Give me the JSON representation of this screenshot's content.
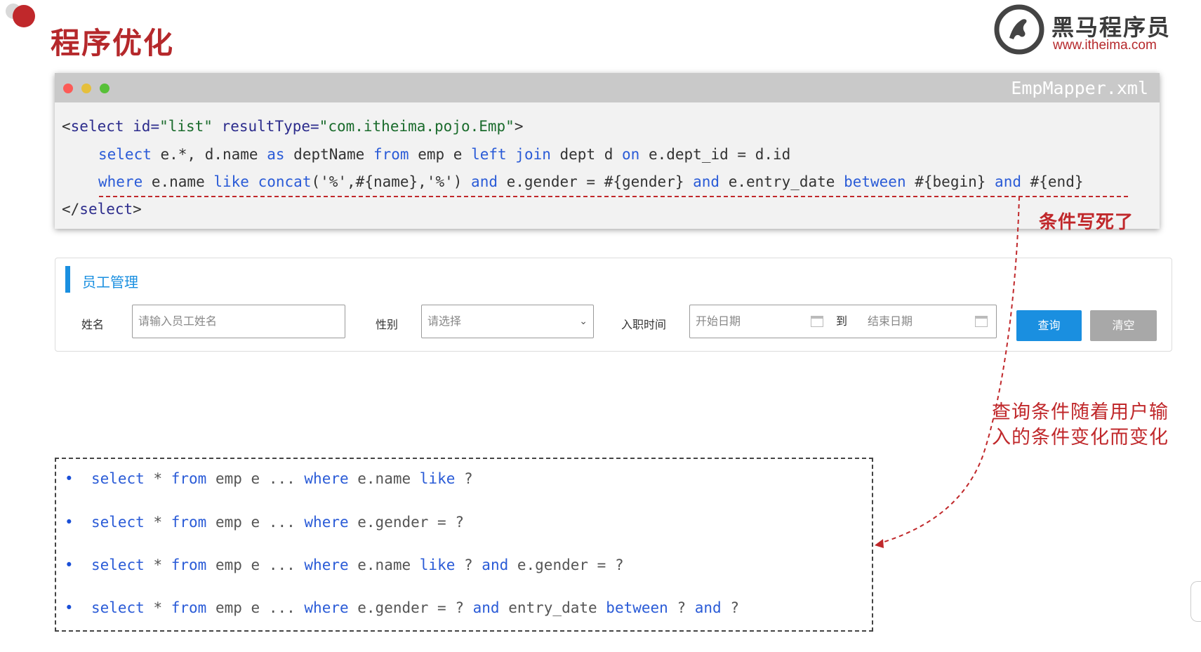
{
  "slide": {
    "title": "程序优化"
  },
  "logo": {
    "name": "黑马程序员",
    "url": "www.itheima.com"
  },
  "code_window": {
    "filename": "EmpMapper.xml",
    "line1": {
      "open": "<",
      "tag": "select",
      "attr1": " id=",
      "val1": "\"list\"",
      "attr2": " resultType=",
      "val2": "\"com.itheima.pojo.Emp\"",
      "close": ">"
    },
    "line2": {
      "select": "select",
      "t1": " e.*, d.name ",
      "as": "as",
      "t2": " deptName ",
      "from": "from",
      "t3": " emp e ",
      "left": "left",
      "sp": " ",
      "join": "join",
      "t4": " dept d ",
      "on": "on",
      "t5": " e.dept_id = d.id"
    },
    "line3": {
      "where": "where",
      "t1": " e.name ",
      "like": "like",
      "sp": " ",
      "concat": "concat",
      "t2": "('%',#{name},'%') ",
      "and1": "and",
      "t3": " e.gender = #{gender} ",
      "and2": "and",
      "t4": " e.entry_date ",
      "between": "between",
      "t5": " #{begin} ",
      "and3": "and",
      "t6": " #{end}"
    },
    "line4": {
      "open": "</",
      "tag": "select",
      "close": ">"
    }
  },
  "annotations": {
    "hardcoded": "条件写死了",
    "dynamic": "查询条件随着用户输入的条件变化而变化"
  },
  "panel": {
    "title": "员工管理",
    "name_label": "姓名",
    "name_placeholder": "请输入员工姓名",
    "gender_label": "性别",
    "gender_placeholder": "请选择",
    "date_label": "入职时间",
    "start_placeholder": "开始日期",
    "to_label": "到",
    "end_placeholder": "结束日期",
    "query_button": "查询",
    "clear_button": "清空"
  },
  "examples": [
    {
      "bullet": "•",
      "select": "select",
      "a": " * ",
      "from": "from",
      "b": " emp e ... ",
      "where": "where",
      "c": " e.name ",
      "k1": "like",
      "d": " ?"
    },
    {
      "bullet": "•",
      "select": "select",
      "a": " * ",
      "from": "from",
      "b": " emp e ... ",
      "where": "where",
      "c": " e.gender = ?"
    },
    {
      "bullet": "•",
      "select": "select",
      "a": " * ",
      "from": "from",
      "b": " emp e ... ",
      "where": "where",
      "c": " e.name ",
      "k1": "like",
      "d": " ? ",
      "k2": "and",
      "e": " e.gender = ?"
    },
    {
      "bullet": "•",
      "select": "select",
      "a": " * ",
      "from": "from",
      "b": " emp e ... ",
      "where": "where",
      "c": " e.gender = ? ",
      "k1": "and",
      "d": " entry_date ",
      "k2": "between",
      "e": " ? ",
      "k3": "and",
      "f": " ?"
    }
  ],
  "colors": {
    "accent_red": "#c0282b",
    "accent_blue": "#1a8fe0",
    "keyword_blue": "#2a5bd7"
  }
}
